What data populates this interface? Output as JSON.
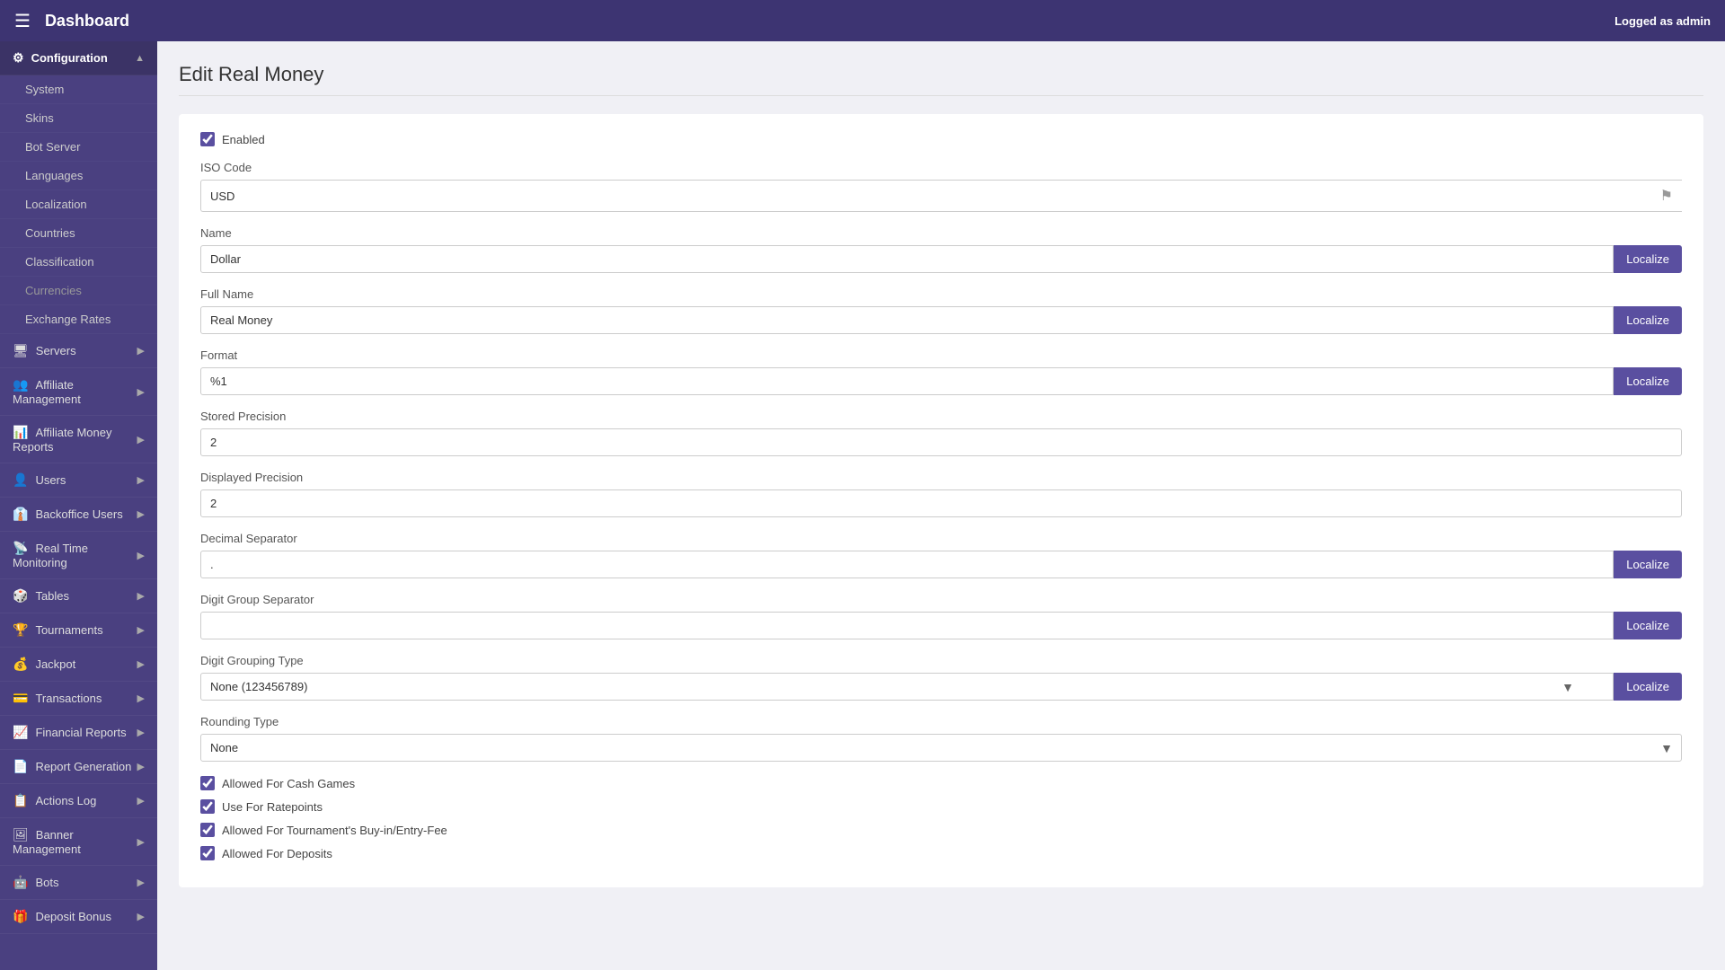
{
  "topbar": {
    "title": "Dashboard",
    "logged_in_label": "Logged as",
    "username": "admin"
  },
  "sidebar": {
    "sections": [
      {
        "id": "configuration",
        "label": "Configuration",
        "icon": "⚙",
        "active": true,
        "has_arrow": true,
        "sub_items": [
          {
            "id": "system",
            "label": "System",
            "active": false
          },
          {
            "id": "skins",
            "label": "Skins",
            "active": false
          },
          {
            "id": "bot-server",
            "label": "Bot Server",
            "active": false
          },
          {
            "id": "languages",
            "label": "Languages",
            "active": false
          },
          {
            "id": "localization",
            "label": "Localization",
            "active": false
          },
          {
            "id": "countries",
            "label": "Countries",
            "active": false
          },
          {
            "id": "classification",
            "label": "Classification",
            "active": false
          },
          {
            "id": "currencies",
            "label": "Currencies",
            "active": false,
            "muted": true
          },
          {
            "id": "exchange-rates",
            "label": "Exchange Rates",
            "active": false
          }
        ]
      },
      {
        "id": "servers",
        "label": "Servers",
        "icon": "🖥",
        "has_arrow": true
      },
      {
        "id": "affiliate-management",
        "label": "Affiliate Management",
        "icon": "👥",
        "has_arrow": true
      },
      {
        "id": "affiliate-money-reports",
        "label": "Affiliate Money Reports",
        "icon": "📊",
        "has_arrow": true
      },
      {
        "id": "users",
        "label": "Users",
        "icon": "👤",
        "has_arrow": true
      },
      {
        "id": "backoffice-users",
        "label": "Backoffice Users",
        "icon": "👔",
        "has_arrow": true
      },
      {
        "id": "real-time-monitoring",
        "label": "Real Time Monitoring",
        "icon": "📡",
        "has_arrow": true
      },
      {
        "id": "tables",
        "label": "Tables",
        "icon": "🎲",
        "has_arrow": true
      },
      {
        "id": "tournaments",
        "label": "Tournaments",
        "icon": "🏆",
        "has_arrow": true
      },
      {
        "id": "jackpot",
        "label": "Jackpot",
        "icon": "💰",
        "has_arrow": true
      },
      {
        "id": "transactions",
        "label": "Transactions",
        "icon": "💳",
        "has_arrow": true
      },
      {
        "id": "financial-reports",
        "label": "Financial Reports",
        "icon": "📈",
        "has_arrow": true
      },
      {
        "id": "report-generation",
        "label": "Report Generation",
        "icon": "📄",
        "has_arrow": true
      },
      {
        "id": "actions-log",
        "label": "Actions Log",
        "icon": "📋",
        "has_arrow": true
      },
      {
        "id": "banner-management",
        "label": "Banner Management",
        "icon": "🖼",
        "has_arrow": true
      },
      {
        "id": "bots",
        "label": "Bots",
        "icon": "🤖",
        "has_arrow": true
      },
      {
        "id": "deposit-bonus",
        "label": "Deposit Bonus",
        "icon": "🎁",
        "has_arrow": true
      }
    ]
  },
  "main": {
    "page_title": "Edit Real Money",
    "form": {
      "enabled_label": "Enabled",
      "enabled_checked": true,
      "iso_code_label": "ISO Code",
      "iso_code_value": "USD",
      "name_label": "Name",
      "name_value": "Dollar",
      "name_localize_btn": "Localize",
      "full_name_label": "Full Name",
      "full_name_value": "Real Money",
      "full_name_localize_btn": "Localize",
      "format_label": "Format",
      "format_value": "%1",
      "format_localize_btn": "Localize",
      "stored_precision_label": "Stored Precision",
      "stored_precision_value": "2",
      "displayed_precision_label": "Displayed Precision",
      "displayed_precision_value": "2",
      "decimal_separator_label": "Decimal Separator",
      "decimal_separator_value": ".",
      "decimal_localize_btn": "Localize",
      "digit_group_separator_label": "Digit Group Separator",
      "digit_group_separator_value": "",
      "digit_group_localize_btn": "Localize",
      "digit_grouping_type_label": "Digit Grouping Type",
      "digit_grouping_type_options": [
        {
          "value": "none",
          "label": "None (123456789)"
        }
      ],
      "digit_grouping_type_selected": "None (123456789)",
      "digit_grouping_localize_btn": "Localize",
      "rounding_type_label": "Rounding Type",
      "rounding_type_options": [
        {
          "value": "none",
          "label": "None"
        }
      ],
      "rounding_type_selected": "None",
      "allowed_cash_games_label": "Allowed For Cash Games",
      "allowed_cash_games_checked": true,
      "use_ratepoints_label": "Use For Ratepoints",
      "use_ratepoints_checked": true,
      "allowed_tournaments_label": "Allowed For Tournament's Buy-in/Entry-Fee",
      "allowed_tournaments_checked": true,
      "allowed_deposits_label": "Allowed For Deposits",
      "allowed_deposits_checked": true
    }
  }
}
